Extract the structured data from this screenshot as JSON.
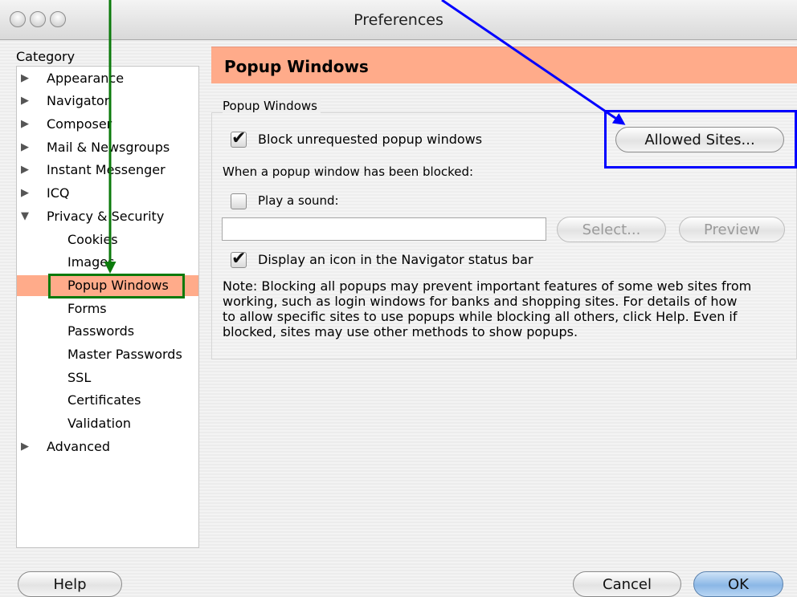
{
  "window": {
    "title": "Preferences"
  },
  "sidebar": {
    "category_label": "Category",
    "items": [
      {
        "label": "Appearance",
        "expander": "▶"
      },
      {
        "label": "Navigator",
        "expander": "▶"
      },
      {
        "label": "Composer",
        "expander": "▶"
      },
      {
        "label": "Mail & Newsgroups",
        "expander": "▶"
      },
      {
        "label": "Instant Messenger",
        "expander": "▶"
      },
      {
        "label": "ICQ",
        "expander": "▶"
      },
      {
        "label": "Privacy & Security",
        "expander": "▼"
      },
      {
        "label": "Cookies"
      },
      {
        "label": "Images"
      },
      {
        "label": "Popup Windows",
        "selected": true
      },
      {
        "label": "Forms"
      },
      {
        "label": "Passwords"
      },
      {
        "label": "Master Passwords"
      },
      {
        "label": "SSL"
      },
      {
        "label": "Certificates"
      },
      {
        "label": "Validation"
      },
      {
        "label": "Advanced",
        "expander": "▶"
      }
    ]
  },
  "panel": {
    "title": "Popup Windows",
    "group_label": "Popup Windows",
    "block_checkbox": {
      "label": "Block unrequested popup windows",
      "checked": true,
      "mark": "✔"
    },
    "allowed_sites_button": "Allowed Sites...",
    "blocked_heading": "When a popup window has been blocked:",
    "sound_checkbox": {
      "label": "Play a sound:",
      "checked": false,
      "mark": ""
    },
    "sound_field_value": "",
    "select_button": "Select...",
    "preview_button": "Preview",
    "icon_checkbox": {
      "label": "Display an icon in the Navigator status bar",
      "checked": true,
      "mark": "✔"
    },
    "note": "Note: Blocking all popups may prevent important features of some web sites from\nworking, such as login windows for banks and shopping sites. For details of how\nto allow specific sites to use popups while blocking all others, click Help. Even if\nblocked, sites may use other methods to show popups."
  },
  "footer": {
    "help": "Help",
    "cancel": "Cancel",
    "ok": "OK"
  },
  "colors": {
    "selection": "#ffab8a",
    "annotation_blue": "#0000ff",
    "annotation_green": "#0b7a0b"
  }
}
